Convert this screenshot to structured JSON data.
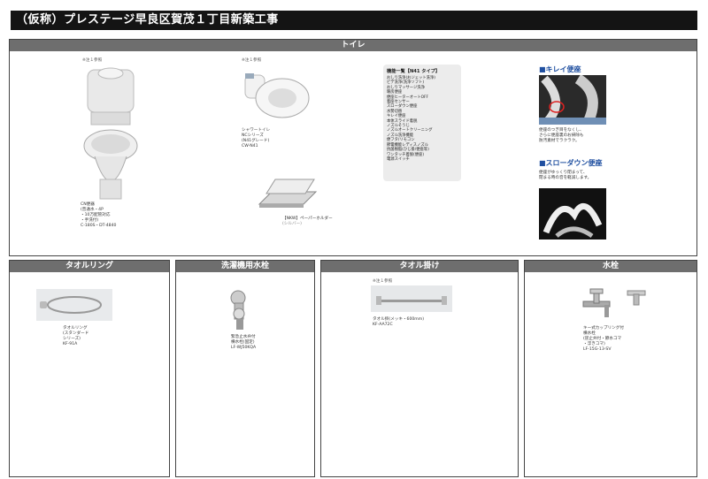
{
  "page": {
    "title": "（仮称）プレステージ早良区賀茂１丁目新築工事"
  },
  "toilet": {
    "header": "トイレ",
    "toilet_note": "※注１参照",
    "toilet_caption": "CN便器\n(普通水・4P\n・10万配管対応\n・手洗付)\nC-180S・DT-4840",
    "washlet_note": "※注１参照",
    "washlet_caption": "シャワートイレ\nNCシリーズ\n(N41グレード)\nCW-N41",
    "holder_caption": "【NKW】ペーパーホルダー",
    "holder_sub": "(シルバー)",
    "features_title": "機能一覧【N41 タイプ】",
    "features": [
      "おしり洗浄(おジェット洗浄)",
      "ビデ洗浄(洗浄ソフト)",
      "おしりマッサージ洗浄",
      "暖房便座",
      "便座ヒーターオートOFF",
      "着座センサー",
      "スローダウン便座",
      "水勢切替",
      "キレイ便座",
      "本体スライド着脱",
      "ノズルそうじ",
      "ノズルオートクリーニング",
      "ノズル洗浄機能",
      "便フタ/リモコン",
      "節電機能レディスノズル",
      "抗菌樹脂(ひじ掛/便座等)",
      "ワンタッチ着脱(便座)",
      "電源スイッチ"
    ],
    "kirei_head": "■キレイ便座",
    "kirei_text": "便座のつぎ目をなくし、\nさらに便座裏のお掃除も\n防汚素材でラクラク。",
    "slowdown_head": "■スローダウン便座",
    "slowdown_text": "便座がゆっくり閉まって、\n閉まる時の音を軽減します。"
  },
  "towel_ring": {
    "header": "タオルリング",
    "caption": "タオルリング\n(スタンダード\nシリーズ)\nKF-91A"
  },
  "washer_faucet": {
    "header": "洗濯機用水栓",
    "caption": "緊急止水弁付\n横水栓(固定)\nLF-WJ50KQA"
  },
  "towel_bar": {
    "header": "タオル掛け",
    "note": "※注１参照",
    "caption": "タオル掛(メッキ・600mm)\nKF-AA72C"
  },
  "faucet": {
    "header": "水栓",
    "caption": "キー式カップリング付\n横水栓\n(逆止弁付・節水コマ\n・浮きコマ)\nLF-15G-13-SV"
  }
}
